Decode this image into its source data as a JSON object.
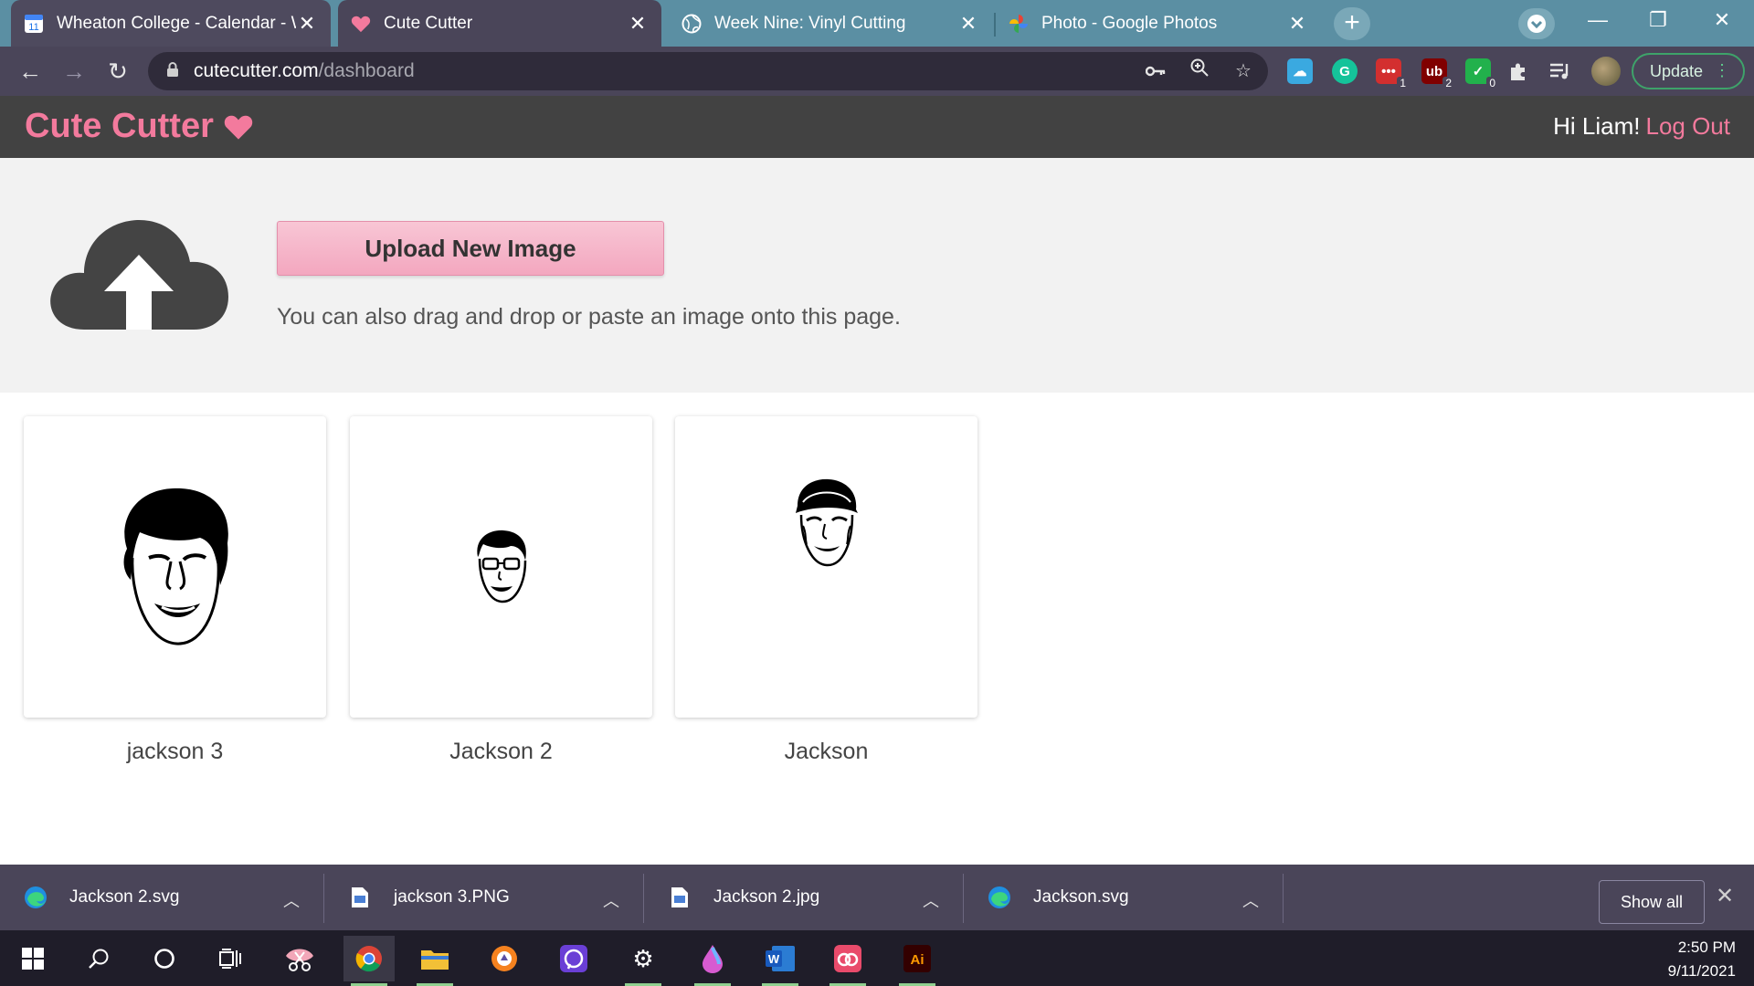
{
  "browser": {
    "tabs": [
      {
        "title": "Wheaton College - Calendar - W",
        "favicon": "calendar-icon",
        "close": "✕"
      },
      {
        "title": "Cute Cutter",
        "favicon": "heart-icon",
        "close": "✕"
      },
      {
        "title": "Week Nine: Vinyl Cutting",
        "favicon": "globe-icon",
        "close": "✕"
      },
      {
        "title": "Photo - Google Photos",
        "favicon": "google-photos-icon",
        "close": "✕"
      }
    ],
    "calendar_favicon_day": "11",
    "url_host": "cutecutter.com",
    "url_path": "/dashboard",
    "update_label": "Update",
    "extension_badges": [
      "1",
      "2",
      "0"
    ]
  },
  "app": {
    "brand": "Cute Cutter",
    "greeting": "Hi Liam!",
    "logout": "Log Out",
    "accent_color": "#f37a9d"
  },
  "upload": {
    "button_label": "Upload New Image",
    "hint": "You can also drag and drop or paste an image onto this page."
  },
  "images": [
    {
      "label": "jackson 3"
    },
    {
      "label": "Jackson 2"
    },
    {
      "label": "Jackson"
    }
  ],
  "downloads": {
    "items": [
      {
        "name": "Jackson 2.svg",
        "icon": "edge-icon"
      },
      {
        "name": "jackson 3.PNG",
        "icon": "image-file-icon"
      },
      {
        "name": "Jackson 2.jpg",
        "icon": "image-file-icon"
      },
      {
        "name": "Jackson.svg",
        "icon": "edge-icon"
      }
    ],
    "show_all": "Show all"
  },
  "taskbar": {
    "time": "2:50 PM",
    "date": "9/11/2021",
    "word_letter": "W",
    "illustrator_letters": "Ai"
  }
}
